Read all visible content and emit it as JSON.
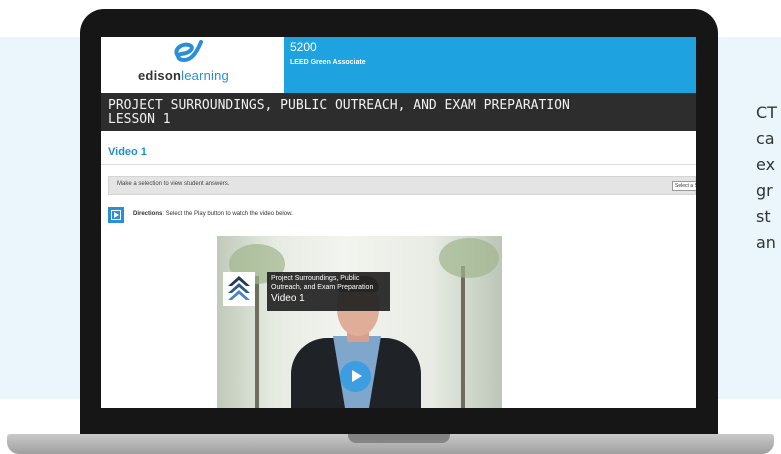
{
  "side_text": [
    "CT",
    "ca",
    "ex",
    "gr",
    "st",
    "an"
  ],
  "app": {
    "logo": {
      "bold": "edison",
      "light": "learning",
      "mark": "·"
    },
    "course_number": "5200",
    "course_name": "LEED Green Associate",
    "title_line1": "PROJECT SURROUNDINGS, PUBLIC OUTREACH, AND EXAM PREPARATION",
    "title_line2": "LESSON 1",
    "section_heading": "Video 1",
    "selection_text": "Make a selection to view student answers.",
    "student_select": "Select a Stude",
    "directions_label": "Directions",
    "directions_text": ": Select the Play button to watch the video below."
  },
  "video": {
    "title_line1": "Project Surroundings, Public",
    "title_line2": "Outreach, and Exam Preparation",
    "title_line3": "Video 1",
    "play_icon": "play-icon"
  },
  "colors": {
    "brand_blue": "#1fa2e0",
    "title_bar": "#2d2d2d",
    "background_panel": "#eaf6fb"
  }
}
